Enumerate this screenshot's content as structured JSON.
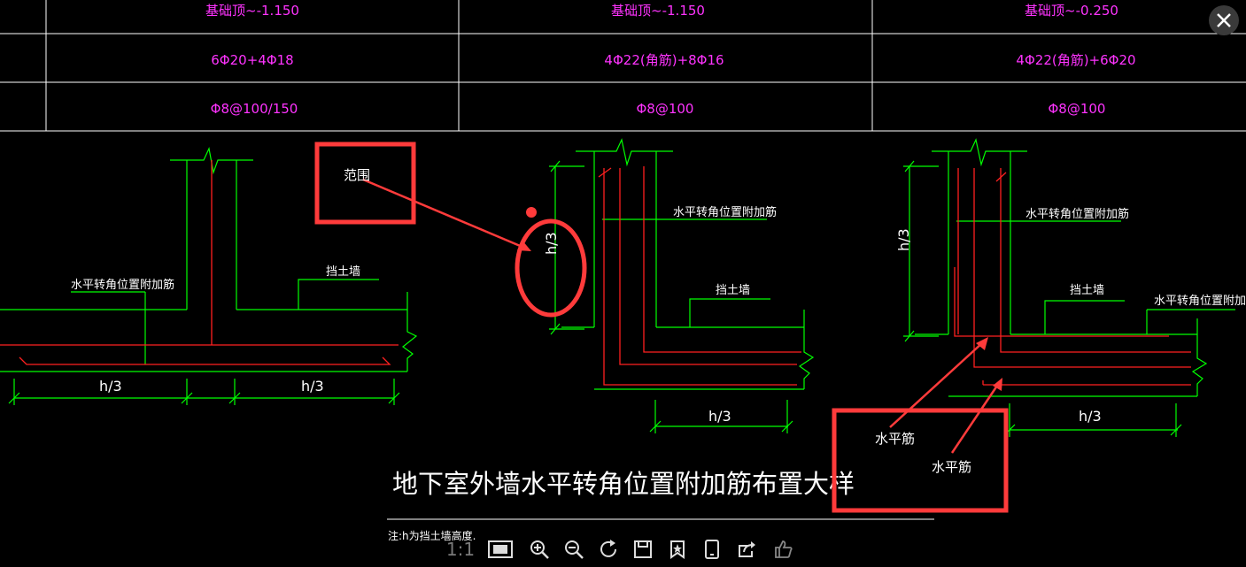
{
  "table": {
    "rows": [
      {
        "cells": [
          "",
          "基础顶~-1.150",
          "基础顶~-1.150",
          "基础顶~-0.250"
        ]
      },
      {
        "cells": [
          "",
          "6Φ20+4Φ18",
          "4Φ22(角筋)+8Φ16",
          "4Φ22(角筋)+6Φ20"
        ]
      },
      {
        "cells": [
          "",
          "Φ8@100/150",
          "Φ8@100",
          "Φ8@100"
        ]
      }
    ],
    "colors": {
      "grid": "#ffffff",
      "text": "#ff33ff"
    }
  },
  "drawing": {
    "title": "地下室外墙水平转角位置附加筋布置大样",
    "note": "注:h为挡土墙高度.",
    "detail1": {
      "rebar_label": "水平转角位置附加筋",
      "wall_label": "挡土墙",
      "dim_left": "h/3",
      "dim_right": "h/3"
    },
    "detail2": {
      "rebar_label": "水平转角位置附加筋",
      "wall_label": "挡土墙",
      "dim_vertical": "h/3",
      "dim_bottom": "h/3"
    },
    "detail3": {
      "rebar_label_top": "水平转角位置附加筋",
      "rebar_label_right": "水平转角位置附加筋",
      "wall_label": "挡土墙",
      "dim_vertical": "h/3",
      "dim_bottom": "h/3"
    },
    "colors": {
      "wall": "#00ff00",
      "rebar": "#ff2020",
      "dim": "#00ff00",
      "text": "#ffffff"
    }
  },
  "annotations": {
    "range_label": "范围",
    "horizontal_bar_label_1": "水平筋",
    "horizontal_bar_label_2": "水平筋",
    "color": "#ff3b3b"
  },
  "toolbar": {
    "scale_label": "1:1",
    "buttons": [
      "fit-screen-icon",
      "zoom-in-icon",
      "zoom-out-icon",
      "rotate-icon",
      "save-icon",
      "bookmark-icon",
      "tablet-icon",
      "share-icon",
      "like-icon"
    ]
  },
  "close_button": {
    "icon": "close-icon"
  }
}
